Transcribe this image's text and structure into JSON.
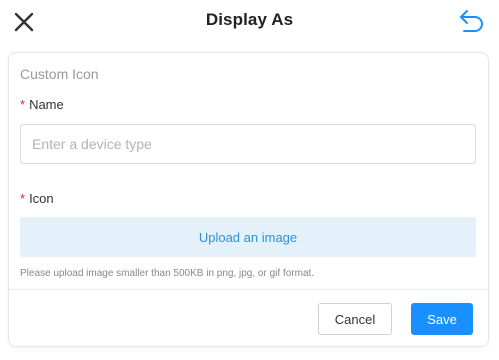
{
  "header": {
    "title": "Display As",
    "close_icon": "close-icon",
    "undo_icon": "undo-arrow-icon"
  },
  "form": {
    "section_title": "Custom Icon",
    "name_field": {
      "required_marker": "*",
      "label": "Name",
      "placeholder": "Enter a device type",
      "value": ""
    },
    "icon_field": {
      "required_marker": "*",
      "label": "Icon",
      "upload_label": "Upload an image",
      "hint": "Please upload image smaller than 500KB in png, jpg, or gif format."
    }
  },
  "footer": {
    "cancel_label": "Cancel",
    "save_label": "Save"
  },
  "colors": {
    "primary": "#1890ff",
    "upload_bg": "#e4f1fb",
    "upload_text": "#2f8fd8",
    "required": "#e0302f"
  }
}
